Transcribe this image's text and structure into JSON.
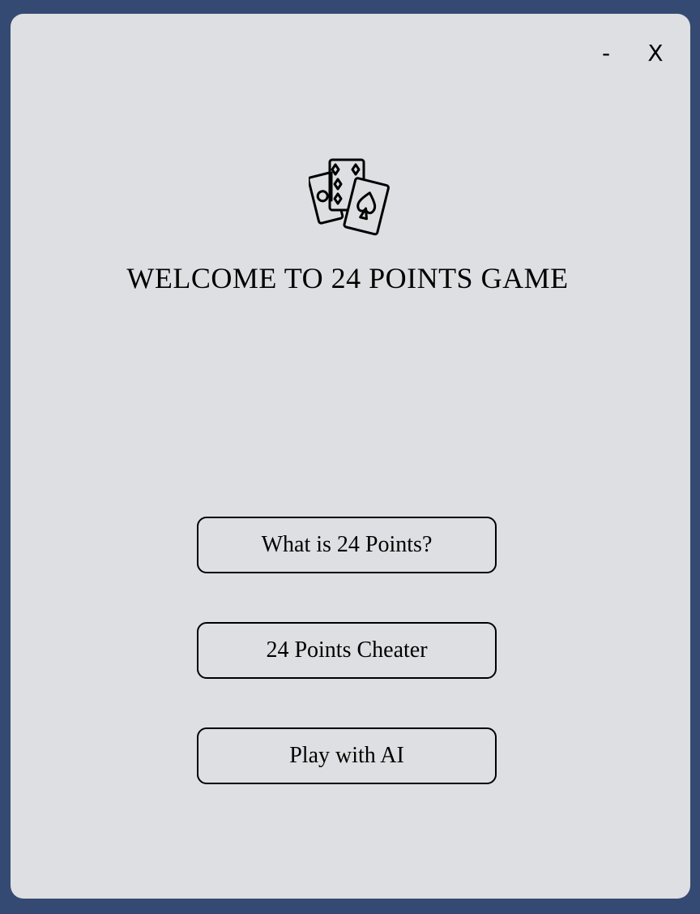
{
  "window": {
    "minimize_label": "-",
    "close_label": "X"
  },
  "header": {
    "logo_icon": "playing-cards-icon",
    "title": "WELCOME TO 24 POINTS GAME"
  },
  "menu": {
    "buttons": [
      {
        "label": "What is 24 Points?"
      },
      {
        "label": "24 Points Cheater"
      },
      {
        "label": "Play with AI"
      }
    ]
  },
  "colors": {
    "background": "#354a73",
    "window": "#dedfe2",
    "text": "#000000"
  }
}
